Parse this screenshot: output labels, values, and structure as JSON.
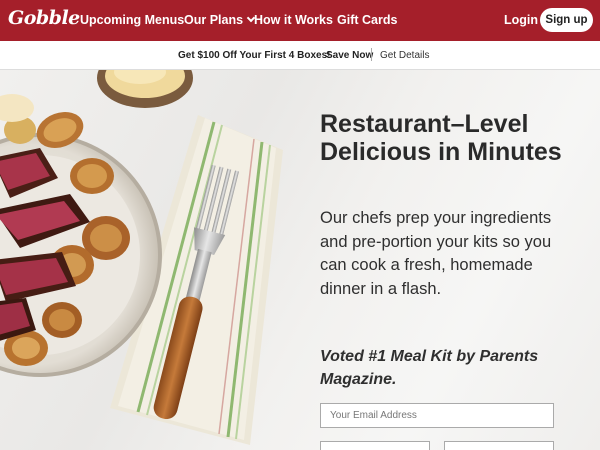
{
  "brand": {
    "logo_text": "Gobble",
    "primary_color": "#a51f2a"
  },
  "nav": {
    "upcoming_menus": "Upcoming Menus",
    "our_plans": "Our Plans",
    "how_it_works": "How it Works",
    "gift_cards": "Gift Cards",
    "login": "Login",
    "signup": "Sign up"
  },
  "promo": {
    "offer": "Get $100 Off Your First 4 Boxes!",
    "save_now": "Save Now",
    "get_details": "Get Details"
  },
  "hero": {
    "headline": "Restaurant–Level Delicious in Minutes",
    "body": "Our chefs prep your ingredients and pre-portion your kits so you can cook a fresh, homemade dinner in a flash.",
    "voted": "Voted #1 Meal Kit by Parents Magazine.",
    "email_placeholder": "Your Email Address",
    "email_value": ""
  },
  "icons": {
    "plans_dropdown": "chevron-down-icon"
  }
}
